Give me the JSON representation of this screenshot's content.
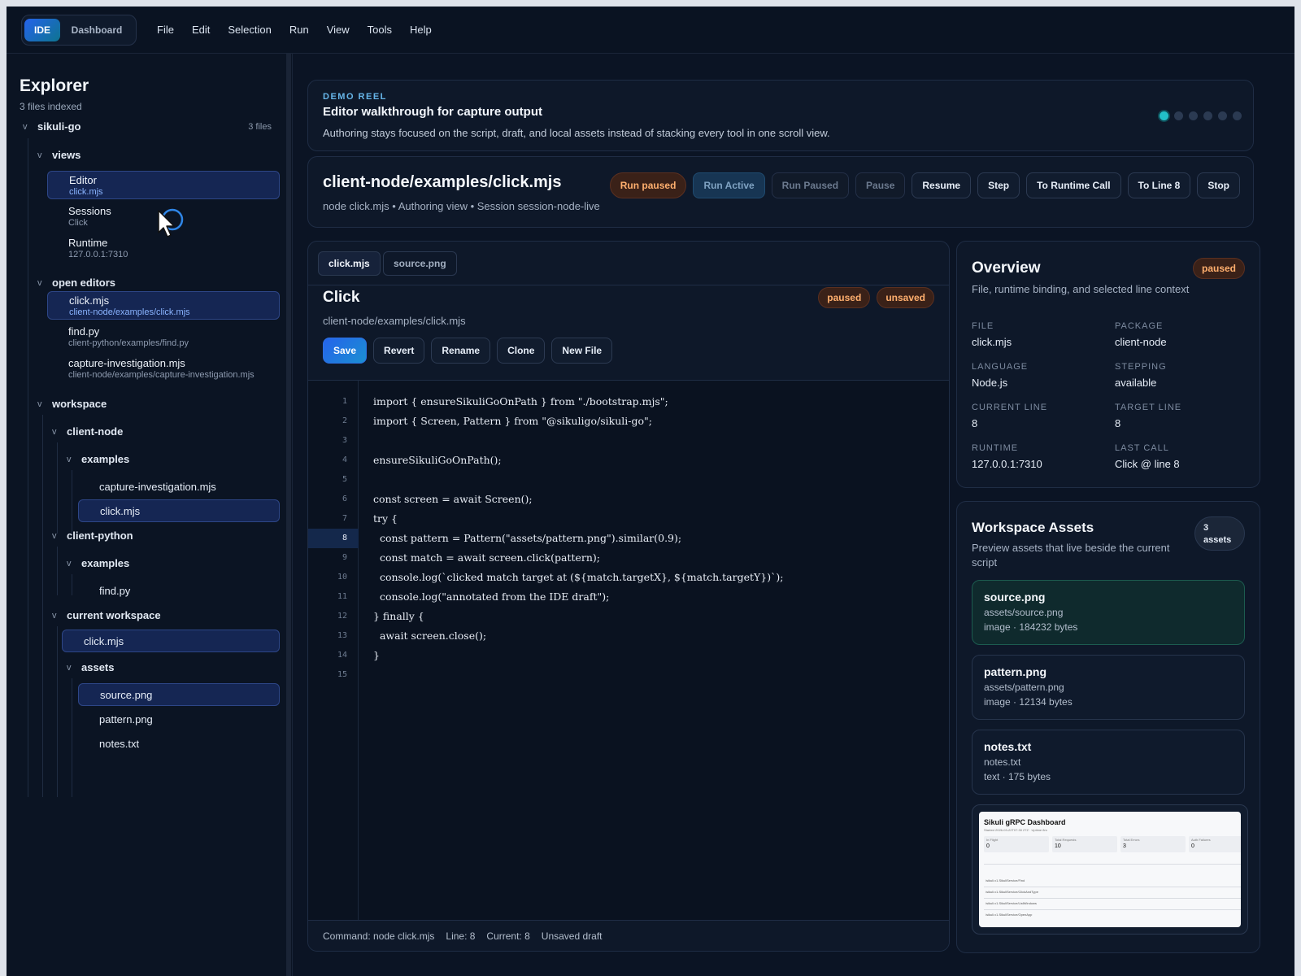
{
  "topbar": {
    "mode_active": "IDE",
    "mode_other": "Dashboard",
    "menu": [
      "File",
      "Edit",
      "Selection",
      "Run",
      "View",
      "Tools",
      "Help"
    ]
  },
  "sidebar": {
    "title": "Explorer",
    "subtitle": "3 files indexed",
    "root": {
      "label": "sikuli-go",
      "count": "3 files"
    },
    "views": {
      "label": "views",
      "items": [
        {
          "label": "Editor",
          "sub": "click.mjs"
        },
        {
          "label": "Sessions",
          "sub": "Click"
        },
        {
          "label": "Runtime",
          "sub": "127.0.0.1:7310"
        }
      ]
    },
    "open_editors": {
      "label": "open editors",
      "items": [
        {
          "label": "click.mjs",
          "sub": "client-node/examples/click.mjs"
        },
        {
          "label": "find.py",
          "sub": "client-python/examples/find.py"
        },
        {
          "label": "capture-investigation.mjs",
          "sub": "client-node/examples/capture-investigation.mjs"
        }
      ]
    },
    "workspace": {
      "label": "workspace",
      "client_node": "client-node",
      "client_node_examples": "examples",
      "client_node_files": [
        "capture-investigation.mjs",
        "click.mjs"
      ],
      "client_python": "client-python",
      "client_python_examples": "examples",
      "client_python_files": [
        "find.py"
      ],
      "current": "current workspace",
      "current_file": "click.mjs",
      "assets": "assets",
      "asset_files": [
        "source.png",
        "pattern.png",
        "notes.txt"
      ]
    },
    "chevron": "v"
  },
  "demo": {
    "kicker": "DEMO REEL",
    "title": "Editor walkthrough for capture output",
    "description": "Authoring stays focused on the script, draft, and local assets instead of stacking every tool in one scroll view.",
    "dots": 6,
    "active_dot": 0
  },
  "header": {
    "path": "client-node/examples/click.mjs",
    "meta": "node click.mjs • Authoring view • Session session-node-live",
    "status_pill": "Run paused",
    "actions": [
      "Run Active",
      "Run Paused",
      "Pause",
      "Resume",
      "Step",
      "To Runtime Call",
      "To Line 8",
      "Stop"
    ]
  },
  "editor": {
    "tabs": [
      "click.mjs",
      "source.png"
    ],
    "title": "Click",
    "path": "client-node/examples/click.mjs",
    "badges": [
      "paused",
      "unsaved"
    ],
    "actions": [
      "Save",
      "Revert",
      "Rename",
      "Clone",
      "New File"
    ],
    "current_line": 8,
    "code": [
      "import { ensureSikuliGoOnPath } from \"./bootstrap.mjs\";",
      "import { Screen, Pattern } from \"@sikuligo/sikuli-go\";",
      "",
      "ensureSikuliGoOnPath();",
      "",
      "const screen = await Screen();",
      "try {",
      "  const pattern = Pattern(\"assets/pattern.png\").similar(0.9);",
      "  const match = await screen.click(pattern);",
      "  console.log(`clicked match target at (${match.targetX}, ${match.targetY})`);",
      "  console.log(\"annotated from the IDE draft\");",
      "} finally {",
      "  await screen.close();",
      "}",
      ""
    ],
    "status": {
      "command": "Command: node click.mjs",
      "line": "Line: 8",
      "current": "Current: 8",
      "draft": "Unsaved draft"
    }
  },
  "overview": {
    "title": "Overview",
    "description": "File, runtime binding, and selected line context",
    "badge": "paused",
    "fields": [
      {
        "key": "FILE",
        "value": "click.mjs"
      },
      {
        "key": "PACKAGE",
        "value": "client-node"
      },
      {
        "key": "LANGUAGE",
        "value": "Node.js"
      },
      {
        "key": "STEPPING",
        "value": "available"
      },
      {
        "key": "CURRENT LINE",
        "value": "8"
      },
      {
        "key": "TARGET LINE",
        "value": "8"
      },
      {
        "key": "RUNTIME",
        "value": "127.0.0.1:7310"
      },
      {
        "key": "LAST CALL",
        "value": "Click @ line 8"
      }
    ]
  },
  "assets": {
    "title": "Workspace Assets",
    "description": "Preview assets that live beside the current script",
    "count_num": "3",
    "count_label": "assets",
    "items": [
      {
        "name": "source.png",
        "path": "assets/source.png",
        "meta": "image · 184232 bytes"
      },
      {
        "name": "pattern.png",
        "path": "assets/pattern.png",
        "meta": "image · 12134 bytes"
      },
      {
        "name": "notes.txt",
        "path": "notes.txt",
        "meta": "text · 175 bytes"
      }
    ],
    "preview": {
      "title": "Sikuli gRPC Dashboard",
      "subtitle": "Started 2026-03-22T07:30 27Z · Uptime 8m",
      "stats": [
        {
          "label": "In Flight",
          "value": "0"
        },
        {
          "label": "Total Requests",
          "value": "10"
        },
        {
          "label": "Total Errors",
          "value": "3"
        },
        {
          "label": "Auth Failures",
          "value": "0"
        }
      ],
      "rows": [
        "/sikuli.v1.SikuliService/Find",
        "/sikuli.v1.SikuliService/ClickAndType",
        "/sikuli.v1.SikuliService/ListWindows",
        "/sikuli.v1.SikuliService/OpenApp"
      ]
    }
  },
  "colors": {
    "accent": "#2563eb",
    "paused": "#ffaf6e",
    "teal": "#22c0c8"
  }
}
